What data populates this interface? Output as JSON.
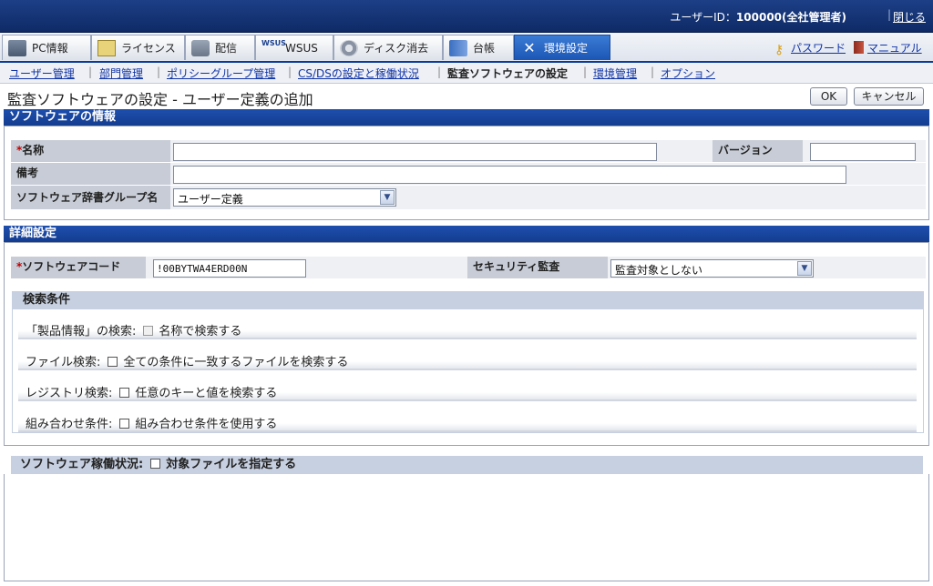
{
  "header": {
    "user_label": "ユーザーID：",
    "user_value": "100000(全社管理者)",
    "separator": "|",
    "logout": "閉じる"
  },
  "tabs": [
    {
      "label": "PC情報",
      "icon": "pc-icon"
    },
    {
      "label": "ライセンス",
      "icon": "license-icon"
    },
    {
      "label": "配信",
      "icon": "distribution-icon"
    },
    {
      "label": "WSUS",
      "icon": "wsus-icon",
      "icon_text": "WSUS"
    },
    {
      "label": "ディスク消去",
      "icon": "disk-erase-icon"
    },
    {
      "label": "台帳",
      "icon": "ledger-icon"
    },
    {
      "label": "環境設定",
      "icon": "tools-icon",
      "active": true
    }
  ],
  "tab_links": {
    "password": "パスワード",
    "manual": "マニュアル"
  },
  "subnav": [
    {
      "label": "ユーザー管理"
    },
    {
      "label": "部門管理"
    },
    {
      "label": "ポリシーグループ管理"
    },
    {
      "label": "CS/DSの設定と稼働状況"
    },
    {
      "label": "監査ソフトウェアの設定",
      "current": true
    },
    {
      "label": "環境管理"
    },
    {
      "label": "オプション"
    }
  ],
  "page": {
    "title": "監査ソフトウェアの設定 - ユーザー定義の追加",
    "ok": "OK",
    "cancel": "キャンセル"
  },
  "software_info": {
    "heading": "ソフトウェアの情報",
    "required_mark": "*",
    "name_label": "名称",
    "name_value": "",
    "version_label": "バージョン",
    "version_value": "",
    "remarks_label": "備考",
    "remarks_value": "",
    "dict_group_label": "ソフトウェア辞書グループ名",
    "dict_group_value": "ユーザー定義"
  },
  "detail": {
    "heading": "詳細設定",
    "required_mark": "*",
    "code_label": "ソフトウェアコード",
    "code_value": "!00BYTWA4ERD00N",
    "security_label": "セキュリティ監査",
    "security_value": "監査対象としない",
    "search_heading": "検索条件",
    "conditions": [
      {
        "label": "「製品情報」の検索:",
        "option": "名称で検索する",
        "checked": false,
        "disabled": true
      },
      {
        "label": "ファイル検索:",
        "option": "全ての条件に一致するファイルを検索する",
        "checked": false
      },
      {
        "label": "レジストリ検索:",
        "option": "任意のキーと値を検索する",
        "checked": false
      },
      {
        "label": "組み合わせ条件:",
        "option": "組み合わせ条件を使用する",
        "checked": false
      }
    ],
    "operation_label": "ソフトウェア稼働状況:",
    "operation_option": "対象ファイルを指定する"
  }
}
